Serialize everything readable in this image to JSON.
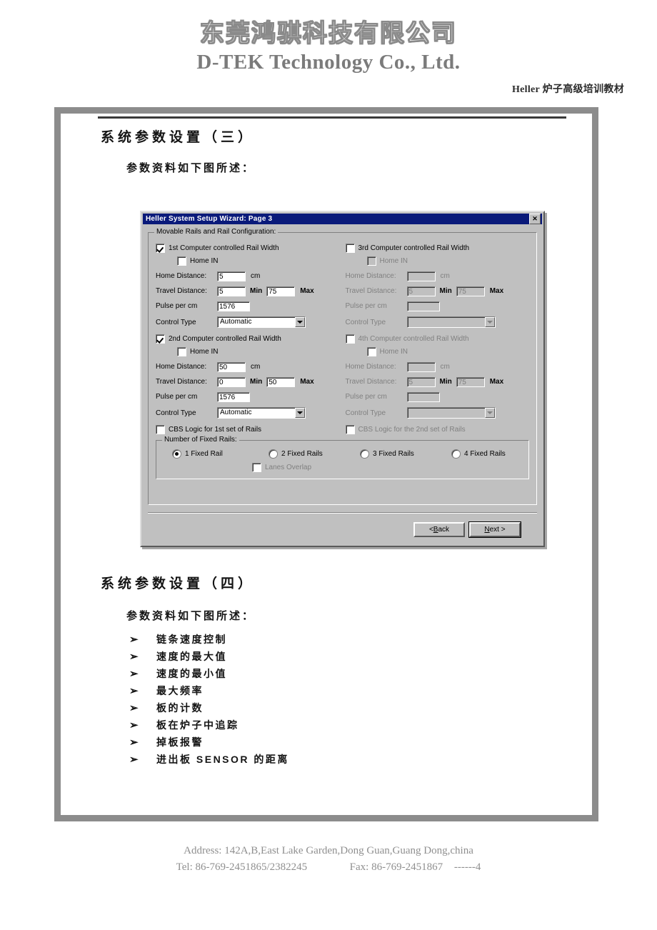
{
  "letterhead": {
    "company_cn": "东莞鸿骐科技有限公司",
    "company_en": "D-TEK Technology Co., Ltd.",
    "doc_subtitle": "Heller 炉子高级培训教材"
  },
  "sections": {
    "section3_title": "系统参数设置（三）",
    "section3_sub": "参数资料如下图所述：",
    "section4_title": "系统参数设置（四）",
    "section4_sub": "参数资料如下图所述："
  },
  "bullets": {
    "mark": "➢",
    "items": [
      "链条速度控制",
      "速度的最大值",
      "速度的最小值",
      "最大频率",
      "板的计数",
      "板在炉子中追踪",
      "掉板报警",
      "进出板 SENSOR 的距离"
    ]
  },
  "dialog": {
    "title": "Heller System Setup Wizard: Page 3",
    "close_icon": "✕",
    "group_label": "Movable Rails and Rail Configuration:",
    "labels": {
      "home_in": "Home IN",
      "home_distance": "Home Distance:",
      "travel_distance": "Travel Distance:",
      "pulse_per_cm": "Pulse per cm",
      "control_type": "Control Type",
      "cm": "cm",
      "min": "Min",
      "max": "Max"
    },
    "rail1": {
      "title": "1st Computer controlled Rail Width",
      "enabled_checked": true,
      "home_in_checked": true,
      "home_distance": "5",
      "travel_min": "5",
      "travel_max": "75",
      "pulse_per_cm": "1576",
      "control_type": "Automatic"
    },
    "rail2": {
      "title": "2nd Computer controlled Rail Width",
      "enabled_checked": true,
      "home_in_checked": false,
      "home_distance": "50",
      "travel_min": "0",
      "travel_max": "50",
      "pulse_per_cm": "1576",
      "control_type": "Automatic"
    },
    "rail3": {
      "title": "3rd Computer controlled Rail Width",
      "enabled_checked": false,
      "home_in_checked": false,
      "home_distance": "",
      "travel_min": "5",
      "travel_max": "75",
      "pulse_per_cm": "",
      "control_type": ""
    },
    "rail4": {
      "title": "4th Computer controlled Rail Width",
      "enabled_checked": false,
      "home_in_checked": false,
      "home_distance": "",
      "travel_min": "5",
      "travel_max": "75",
      "pulse_per_cm": "",
      "control_type": ""
    },
    "cbs1": "CBS Logic for 1st set of Rails",
    "cbs2": "CBS Logic for the 2nd set of Rails",
    "fixed_rails": {
      "group_label": "Number of Fixed Rails:",
      "options": [
        "1 Fixed Rail",
        "2 Fixed Rails",
        "3 Fixed Rails",
        "4 Fixed Rails"
      ],
      "selected_index": 0,
      "lanes_overlap": "Lanes Overlap",
      "lanes_overlap_checked": false
    },
    "buttons": {
      "back_prefix": "< ",
      "back_mnemonic": "B",
      "back_suffix": "ack",
      "next_mnemonic": "N",
      "next_suffix": "ext >"
    }
  },
  "footer": {
    "address": "Address: 142A,B,East Lake Garden,Dong Guan,Guang Dong,china",
    "tel": "Tel: 86-769-2451865/2382245",
    "fax": "Fax: 86-769-2451867",
    "page": "------4"
  },
  "colors": {
    "titlebar": "#0a1a7a",
    "dialog_face": "#c0c0c0",
    "frame": "#8c8c8c",
    "footer_text": "#8f8f8f"
  }
}
